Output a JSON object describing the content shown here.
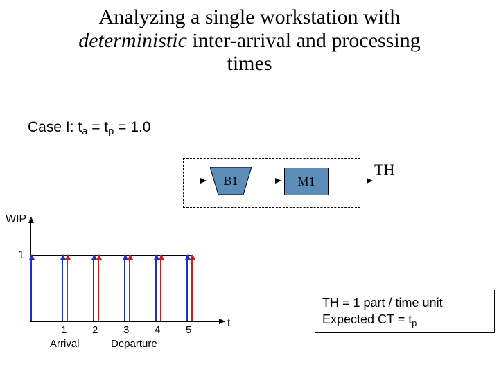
{
  "title": {
    "line1_pre": "Analyzing a single workstation with",
    "line2_em": "deterministic",
    "line2_rest": " inter-arrival and processing",
    "line3": "times"
  },
  "case_label_pre": "Case I: t",
  "case_sub_a": "a",
  "case_mid": " = t",
  "case_sub_p": "p",
  "case_rest": " = 1.0",
  "workstation": {
    "buffer_label": "B1",
    "machine_label": "M1",
    "output_label": "TH"
  },
  "chart_data": {
    "type": "event-timeline",
    "y_label": "WIP",
    "y_tick": "1",
    "x_label": "t",
    "x_ticks": [
      "1",
      "2",
      "3",
      "4",
      "5"
    ],
    "legend": {
      "arrival": "Arrival",
      "departure": "Departure"
    },
    "arrivals_at": [
      0,
      1,
      2,
      3,
      4,
      5
    ],
    "departures_at": [
      1,
      2,
      3,
      4,
      5
    ],
    "wip_level": 1
  },
  "equations": {
    "line1": "TH = 1 part / time unit",
    "line2_pre": "Expected CT = t",
    "line2_sub": "p"
  }
}
